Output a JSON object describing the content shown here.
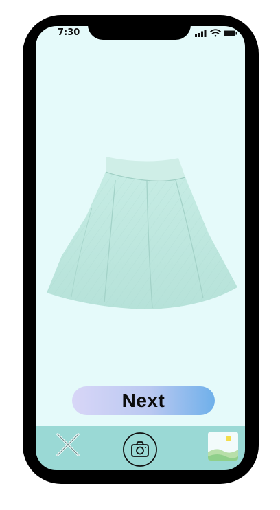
{
  "status_bar": {
    "time": "7:30",
    "icons": [
      "signal-icon",
      "wifi-icon",
      "battery-icon"
    ]
  },
  "photo": {
    "subject": "mint-green-flared-skirt"
  },
  "cta": {
    "label": "Next"
  },
  "toolbar": {
    "items": [
      "close-icon",
      "camera-icon",
      "gallery-icon"
    ]
  },
  "colors": {
    "screen_background": "#e5fafa",
    "toolbar_background": "#9ad9d5",
    "cta_gradient_start": "#d8d6f7",
    "cta_gradient_end": "#6fb0ea",
    "skirt": "#bfe8df",
    "phone_frame": "#000000"
  }
}
